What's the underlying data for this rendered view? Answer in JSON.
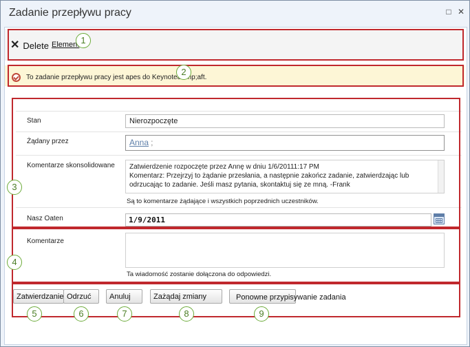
{
  "window": {
    "title": "Zadanie przepływu pracy",
    "maximize_icon": "maximize-icon",
    "close_icon": "close-icon"
  },
  "ribbon": {
    "delete_label": "Delete",
    "element_label": "Element",
    "delete_icon": "delete-x-icon"
  },
  "status": {
    "text": "To zadanie przepływu pracy jest apes do Keynote&amp;aft.",
    "icon": "workflow-status-icon"
  },
  "form": {
    "status_label": "Stan",
    "status_value": "Nierozpoczęte",
    "requested_by_label": "Żądany przez",
    "requested_by_name": "Anna",
    "requested_by_sep": ";",
    "consolidated_label": "Komentarze skonsolidowane",
    "consolidated_text": "Zatwierdzenie rozpoczęte przez Annę w dniu 1/6/20111:17 PM\nKomentarz: Przejrzyj to żądanie przesłania, a następnie zakończ zadanie, zatwierdzając lub odrzucając to zadanie. Jeśli masz pytania, skontaktuj się ze mną. -Frank",
    "consolidated_note": "Są to komentarze żądające i wszystkich poprzednich uczestników.",
    "due_label": "Nasz Oaten",
    "due_value": "1/9/2011",
    "comments_label": "Komentarze",
    "comments_value": "",
    "comments_note": "Ta wiadomość zostanie dołączona do odpowiedzi."
  },
  "buttons": {
    "approve": "Zatwierdzanie",
    "reject": "Odrzuć",
    "cancel": "Anuluj",
    "request_change": "Zażądaj zmiany",
    "reassign": "Ponowne przypisywanie zadania"
  },
  "callouts": [
    "1",
    "2",
    "3",
    "4",
    "5",
    "6",
    "7",
    "8",
    "9"
  ],
  "colors": {
    "callout_border": "#6cab3a",
    "highlight_box": "#c0282d",
    "status_background": "#fdf6d6",
    "people_link": "#5e7fa9"
  }
}
